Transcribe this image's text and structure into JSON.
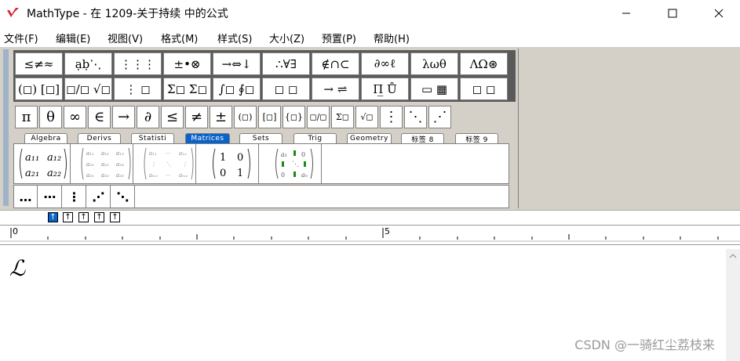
{
  "window": {
    "title": "MathType - 在 1209-关于持续 中的公式",
    "controls": [
      "minimize-icon",
      "maximize-icon",
      "close-icon"
    ],
    "accent_color": "#d9232d"
  },
  "menu": [
    {
      "label": "文件(F)"
    },
    {
      "label": "编辑(E)"
    },
    {
      "label": "视图(V)"
    },
    {
      "label": "格式(M)"
    },
    {
      "label": "样式(S)"
    },
    {
      "label": "大小(Z)"
    },
    {
      "label": "预置(P)"
    },
    {
      "label": "帮助(H)"
    }
  ],
  "palette_row1": [
    "≤≠≈",
    "ạḅ⋱",
    "⋮⋮⋮",
    "±•⊗",
    "→⇔↓",
    "∴∀∃",
    "∉∩⊂",
    "∂∞ℓ",
    "λωθ",
    "ΛΩ⊛"
  ],
  "palette_row2": [
    "(◻) [◻]",
    "◻/◻ √◻",
    "⋮ ◻",
    "Σ◻ Σ◻",
    "∫◻ ∮◻",
    "◻ ◻",
    "→ ⇌",
    "Π̲ Ů",
    "▭ ▦",
    "◻ ◻"
  ],
  "small_bar": [
    "π",
    "θ",
    "∞",
    "∈",
    "→",
    "∂",
    "≤",
    "≠",
    "±",
    "(◻)",
    "[◻]",
    "{◻}",
    "◻/◻",
    "Σ◻",
    "√◻",
    "⋮",
    "⋱",
    "⋰"
  ],
  "tabs": [
    {
      "label": "Algebra",
      "active": false
    },
    {
      "label": "Derivs",
      "active": false
    },
    {
      "label": "Statisti",
      "active": false
    },
    {
      "label": "Matrices",
      "active": true
    },
    {
      "label": "Sets",
      "active": false
    },
    {
      "label": "Trig",
      "active": false
    },
    {
      "label": "Geometry",
      "active": false
    },
    {
      "label": "标签 8",
      "active": false
    },
    {
      "label": "标签 9",
      "active": false
    }
  ],
  "matrices": [
    {
      "tl": "a₁₁",
      "tr": "a₁₂",
      "bl": "a₂₁",
      "br": "a₂₂"
    },
    {
      "grid": "a₁₁ a₁₂ a₁₃ / a₂₁ a₂₂ a₂₃ / a₃₁ a₃₂ a₃₃"
    },
    {
      "grid": "a₁₁ ⋯ a₁ₙ / ⋮ ⋱ ⋮ / aₘ₁ ⋯ aₘₙ"
    },
    {
      "tl": "1",
      "tr": "0",
      "bl": "0",
      "br": "1"
    },
    {
      "grid": "a₁ 0 / ⋱ / 0 aₙ"
    }
  ],
  "dots": [
    "…",
    "⋯",
    "⋮",
    "⋰",
    "⋱"
  ],
  "size_buttons": 5,
  "ruler": {
    "marks": [
      "0",
      "5"
    ]
  },
  "editor": {
    "content": "ℒ"
  },
  "watermark": "CSDN @一骑红尘荔枝来"
}
